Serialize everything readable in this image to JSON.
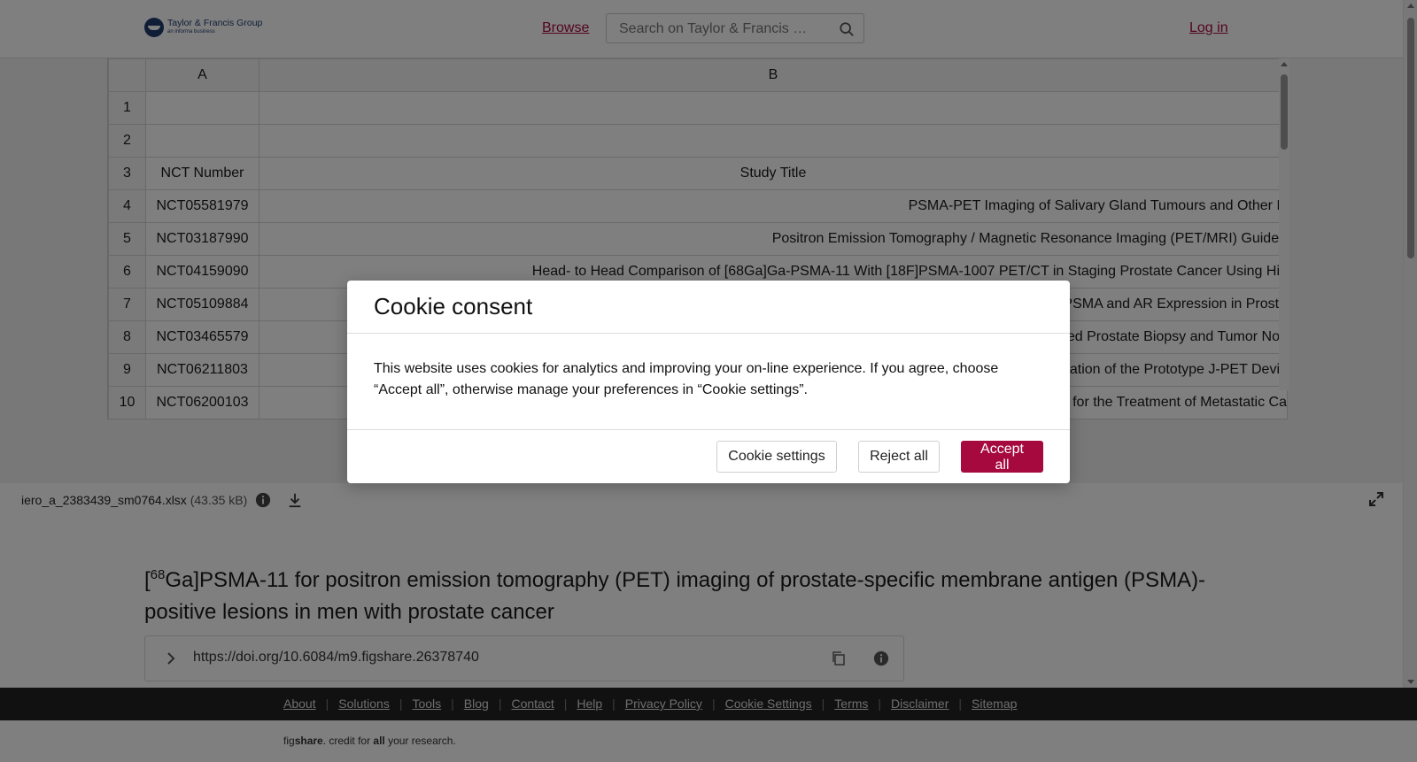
{
  "header": {
    "logo_main": "Taylor & Francis Group",
    "logo_sub": "an informa business",
    "browse_label": "Browse",
    "search_placeholder": "Search on Taylor & Francis …",
    "login_label": "Log in"
  },
  "spreadsheet": {
    "columns": [
      "A",
      "B"
    ],
    "rows": [
      {
        "num": "1",
        "nct": "",
        "title": ""
      },
      {
        "num": "2",
        "nct": "",
        "title": ""
      },
      {
        "num": "3",
        "nct": "NCT Number",
        "title": "Study Title"
      },
      {
        "num": "4",
        "nct": "NCT05581979",
        "title": "PSMA-PET Imaging of Salivary Gland Tumours and Other R"
      },
      {
        "num": "5",
        "nct": "NCT03187990",
        "title": "Positron Emission Tomography / Magnetic Resonance Imaging (PET/MRI) Guided"
      },
      {
        "num": "6",
        "nct": "NCT04159090",
        "title": "Head- to Head Comparison of [68Ga]Ga-PSMA-11 With [18F]PSMA-1007 PET/CT in Staging Prostate Cancer Using His"
      },
      {
        "num": "7",
        "nct": "NCT05109884",
        "title": "PSMA and AR Expression in Prosta"
      },
      {
        "num": "8",
        "nct": "NCT03465579",
        "title": "ed Prostate Biopsy and Tumor Noc"
      },
      {
        "num": "9",
        "nct": "NCT06211803",
        "title": "ation of the Prototype J-PET Devic"
      },
      {
        "num": "10",
        "nct": "NCT06200103",
        "title": "for the Treatment of Metastatic Ca"
      }
    ]
  },
  "file": {
    "name": "iero_a_2383439_sm0764.xlsx",
    "size": "(43.35 kB)"
  },
  "article": {
    "title_prefix": "[",
    "title_sup": "68",
    "title_rest": "Ga]PSMA-11 for positron emission tomography (PET) imaging of prostate-specific membrane antigen (PSMA)-positive lesions in men with prostate cancer",
    "doi": "https://doi.org/10.6084/m9.figshare.26378740"
  },
  "footer": {
    "links": [
      "About",
      "Solutions",
      "Tools",
      "Blog",
      "Contact",
      "Help",
      "Privacy Policy",
      "Cookie Settings",
      "Terms",
      "Disclaimer",
      "Sitemap"
    ],
    "tagline_fig": "fig",
    "tagline_share": "share",
    "tagline_mid": ". credit for ",
    "tagline_all": "all",
    "tagline_end": " your research."
  },
  "cookie_modal": {
    "title": "Cookie consent",
    "body": "This website uses cookies for analytics and improving your on-line experience. If you agree, choose “Accept all”, otherwise manage your preferences in “Cookie settings”.",
    "settings_label": "Cookie settings",
    "reject_label": "Reject all",
    "accept_label": "Accept all"
  },
  "colors": {
    "brand": "#a6093d",
    "overlay": "rgba(0,0,0,0.5)"
  },
  "icons": [
    "search-icon",
    "info-icon",
    "download-icon",
    "expand-icon",
    "chevron-right-icon",
    "copy-icon"
  ]
}
